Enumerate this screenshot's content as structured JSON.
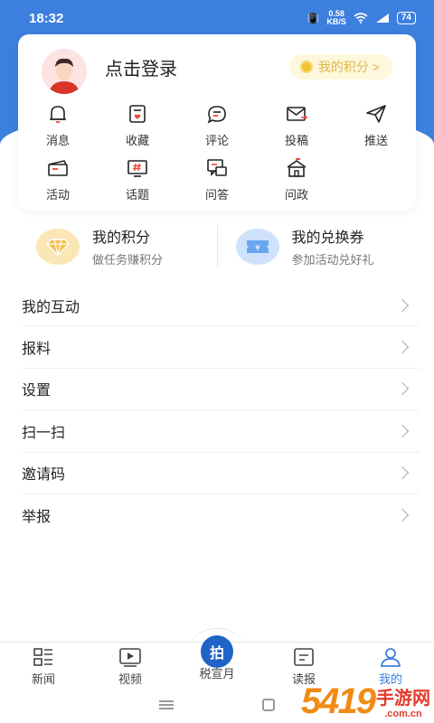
{
  "status": {
    "time": "18:32",
    "speed_value": "0.58",
    "speed_unit": "KB/S",
    "battery": "74"
  },
  "profile": {
    "login_text": "点击登录",
    "points_pill": "我的积分 >"
  },
  "grid": [
    {
      "label": "消息",
      "icon": "bell-icon"
    },
    {
      "label": "收藏",
      "icon": "favorite-icon"
    },
    {
      "label": "评论",
      "icon": "comment-icon"
    },
    {
      "label": "投稿",
      "icon": "mail-icon"
    },
    {
      "label": "推送",
      "icon": "send-icon"
    },
    {
      "label": "活动",
      "icon": "ticket-icon"
    },
    {
      "label": "话题",
      "icon": "topic-icon"
    },
    {
      "label": "问答",
      "icon": "qa-icon"
    },
    {
      "label": "问政",
      "icon": "government-icon"
    }
  ],
  "summary": {
    "points": {
      "title": "我的积分",
      "subtitle": "做任务赚积分"
    },
    "coupons": {
      "title": "我的兑换券",
      "subtitle": "参加活动兑好礼"
    }
  },
  "menu": [
    "我的互动",
    "报料",
    "设置",
    "扫一扫",
    "邀请码",
    "举报"
  ],
  "tabs": {
    "news": "新闻",
    "video": "视频",
    "center_button": "拍",
    "center_label": "税宣月",
    "paper": "读报",
    "mine": "我的"
  },
  "watermark": {
    "number": "5419",
    "name": "手游网",
    "url": ".com.cn"
  },
  "colors": {
    "primary": "#3d7fde",
    "gold": "#e0b84a",
    "pill_bg": "#fdf7dc"
  }
}
